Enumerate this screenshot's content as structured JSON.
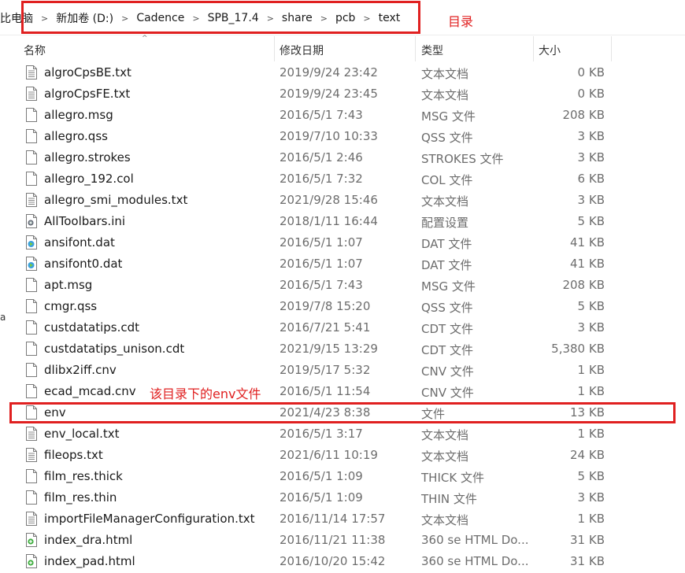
{
  "address_bar": {
    "partial_left": "比电脑",
    "crumbs": [
      "新加卷 (D:)",
      "Cadence",
      "SPB_17.4",
      "share",
      "pcb",
      "text"
    ]
  },
  "annotations": {
    "directory_note": "目录",
    "env_note": "该目录下的env文件",
    "color": "#e02020"
  },
  "columns": {
    "name": "名称",
    "date": "修改日期",
    "type": "类型",
    "size": "大小"
  },
  "left_edge_text": "a",
  "files": [
    {
      "name": "algroCpsBE.txt",
      "date": "2019/9/24 23:42",
      "type": "文本文档",
      "size": "0 KB",
      "icon": "text-file-icon"
    },
    {
      "name": "algroCpsFE.txt",
      "date": "2019/9/24 23:45",
      "type": "文本文档",
      "size": "0 KB",
      "icon": "text-file-icon"
    },
    {
      "name": "allegro.msg",
      "date": "2016/5/1 7:43",
      "type": "MSG 文件",
      "size": "208 KB",
      "icon": "blank-file-icon"
    },
    {
      "name": "allegro.qss",
      "date": "2019/7/10 10:33",
      "type": "QSS 文件",
      "size": "3 KB",
      "icon": "blank-file-icon"
    },
    {
      "name": "allegro.strokes",
      "date": "2016/5/1 2:46",
      "type": "STROKES 文件",
      "size": "3 KB",
      "icon": "blank-file-icon"
    },
    {
      "name": "allegro_192.col",
      "date": "2016/5/1 7:32",
      "type": "COL 文件",
      "size": "6 KB",
      "icon": "blank-file-icon"
    },
    {
      "name": "allegro_smi_modules.txt",
      "date": "2021/9/28 15:46",
      "type": "文本文档",
      "size": "3 KB",
      "icon": "text-file-icon"
    },
    {
      "name": "AllToolbars.ini",
      "date": "2018/1/11 16:44",
      "type": "配置设置",
      "size": "5 KB",
      "icon": "ini-file-icon"
    },
    {
      "name": "ansifont.dat",
      "date": "2016/5/1 1:07",
      "type": "DAT 文件",
      "size": "41 KB",
      "icon": "media-file-icon"
    },
    {
      "name": "ansifont0.dat",
      "date": "2016/5/1 1:07",
      "type": "DAT 文件",
      "size": "41 KB",
      "icon": "media-file-icon"
    },
    {
      "name": "apt.msg",
      "date": "2016/5/1 7:43",
      "type": "MSG 文件",
      "size": "208 KB",
      "icon": "blank-file-icon"
    },
    {
      "name": "cmgr.qss",
      "date": "2019/7/8 15:20",
      "type": "QSS 文件",
      "size": "5 KB",
      "icon": "blank-file-icon"
    },
    {
      "name": "custdatatips.cdt",
      "date": "2016/7/21 5:41",
      "type": "CDT 文件",
      "size": "3 KB",
      "icon": "blank-file-icon"
    },
    {
      "name": "custdatatips_unison.cdt",
      "date": "2021/9/15 13:29",
      "type": "CDT 文件",
      "size": "5,380 KB",
      "icon": "blank-file-icon"
    },
    {
      "name": "dlibx2iff.cnv",
      "date": "2019/5/17 5:32",
      "type": "CNV 文件",
      "size": "1 KB",
      "icon": "blank-file-icon"
    },
    {
      "name": "ecad_mcad.cnv",
      "date": "2016/5/1 11:54",
      "type": "CNV 文件",
      "size": "1 KB",
      "icon": "blank-file-icon"
    },
    {
      "name": "env",
      "date": "2021/4/23 8:38",
      "type": "文件",
      "size": "13 KB",
      "icon": "blank-file-icon"
    },
    {
      "name": "env_local.txt",
      "date": "2016/5/1 3:17",
      "type": "文本文档",
      "size": "1 KB",
      "icon": "text-file-icon"
    },
    {
      "name": "fileops.txt",
      "date": "2021/6/11 10:19",
      "type": "文本文档",
      "size": "24 KB",
      "icon": "text-file-icon"
    },
    {
      "name": "film_res.thick",
      "date": "2016/5/1 1:09",
      "type": "THICK 文件",
      "size": "5 KB",
      "icon": "blank-file-icon"
    },
    {
      "name": "film_res.thin",
      "date": "2016/5/1 1:09",
      "type": "THIN 文件",
      "size": "3 KB",
      "icon": "blank-file-icon"
    },
    {
      "name": "importFileManagerConfiguration.txt",
      "date": "2016/11/14 17:57",
      "type": "文本文档",
      "size": "1 KB",
      "icon": "text-file-icon"
    },
    {
      "name": "index_dra.html",
      "date": "2016/11/21 11:38",
      "type": "360 se HTML Do...",
      "size": "31 KB",
      "icon": "html-file-icon"
    },
    {
      "name": "index_pad.html",
      "date": "2016/10/20 15:42",
      "type": "360 se HTML Do...",
      "size": "31 KB",
      "icon": "html-file-icon"
    }
  ]
}
